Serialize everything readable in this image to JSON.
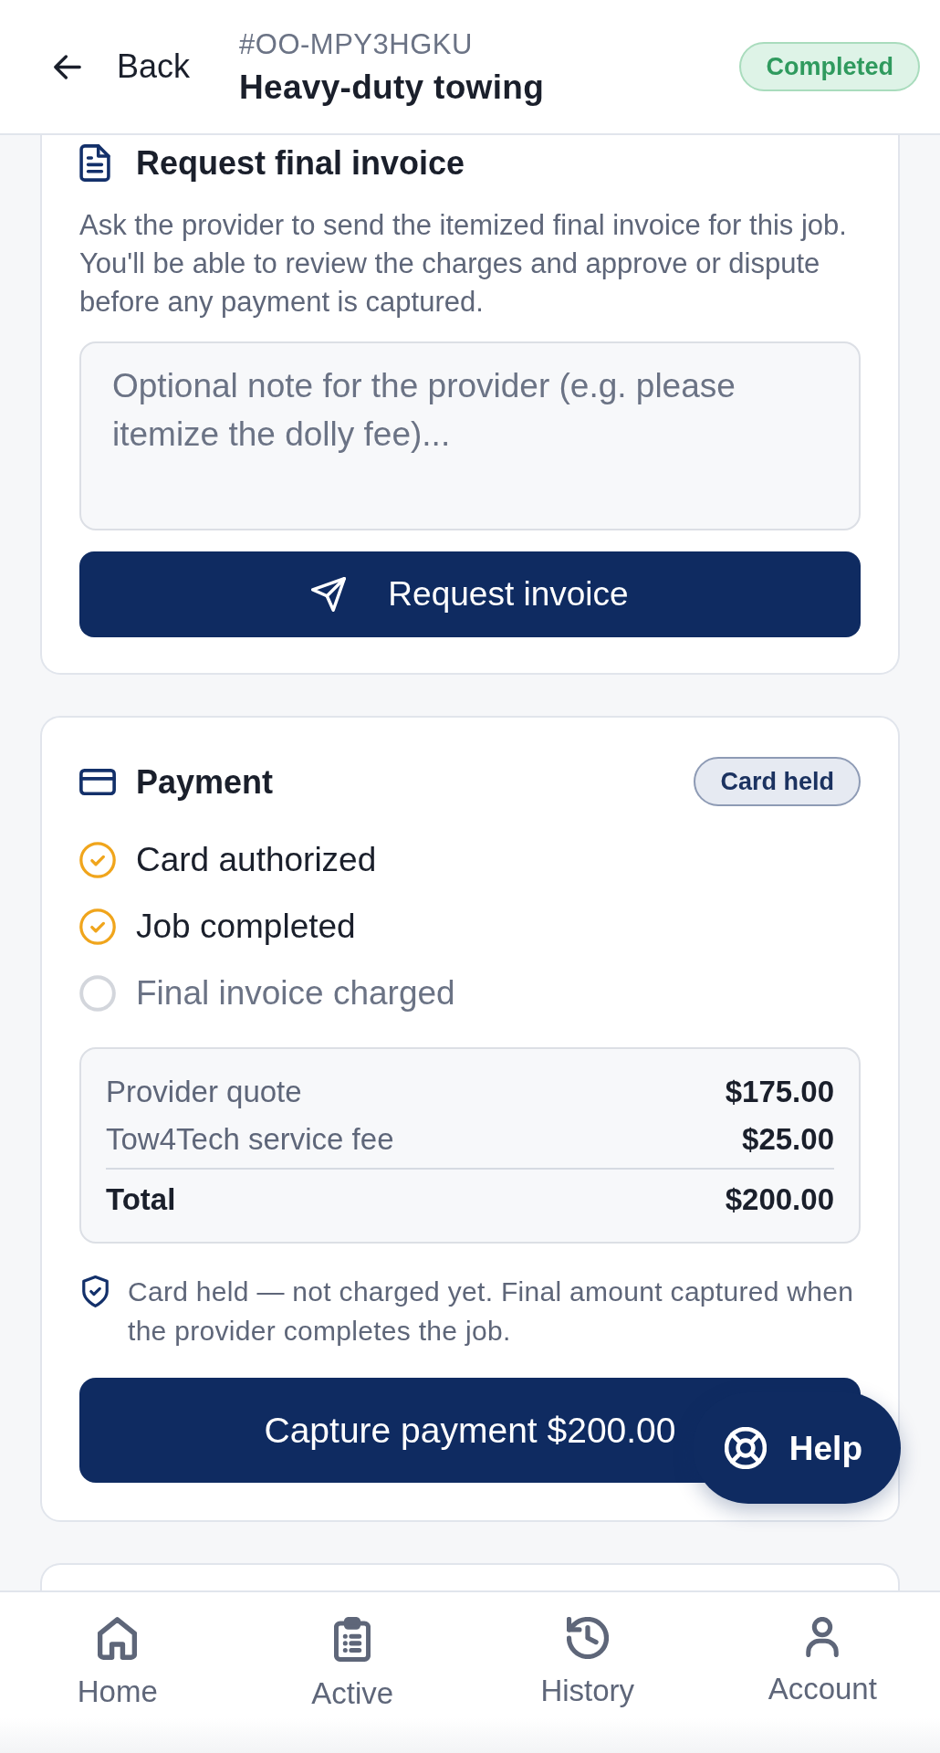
{
  "header": {
    "back_label": "Back",
    "order_id": "#OO-MPY3HGKU",
    "title": "Heavy-duty towing",
    "status": "Completed"
  },
  "invoice_request": {
    "title": "Request final invoice",
    "description": "Ask the provider to send the itemized final invoice for this job. You'll be able to review the charges and approve or dispute before any payment is captured.",
    "note_field": {
      "placeholder": "Optional note for the provider (e.g. please itemize the dolly fee)..."
    },
    "button": "Request invoice"
  },
  "payment": {
    "title": "Payment",
    "badge": "Card held",
    "steps": [
      {
        "label": "Card authorized",
        "done": true
      },
      {
        "label": "Job completed",
        "done": true
      },
      {
        "label": "Final invoice charged",
        "done": false
      }
    ],
    "summary": [
      {
        "kind": "line",
        "label": "Provider quote",
        "value": "$175.00"
      },
      {
        "kind": "line",
        "label": "Tow4Tech service fee",
        "value": "$25.00"
      },
      {
        "kind": "total",
        "label": "Total",
        "value": "$200.00"
      }
    ],
    "note": "Card held — not charged yet. Final amount captured when the provider completes the job.",
    "button": "Capture payment $200.00"
  },
  "help_button": {
    "label": "Help"
  },
  "bottom_nav": [
    {
      "label": "Home",
      "selected": false
    },
    {
      "label": "Active",
      "selected": false
    },
    {
      "label": "History",
      "selected": false
    },
    {
      "label": "Account",
      "selected": false
    }
  ]
}
